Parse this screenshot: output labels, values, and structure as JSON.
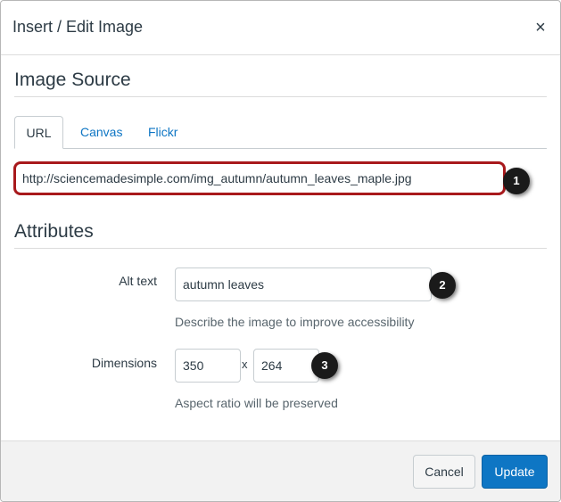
{
  "dialog": {
    "title": "Insert / Edit Image",
    "close_glyph": "×"
  },
  "image_source": {
    "heading": "Image Source",
    "tabs": [
      {
        "label": "URL",
        "active": true
      },
      {
        "label": "Canvas",
        "active": false
      },
      {
        "label": "Flickr",
        "active": false
      }
    ],
    "url_value": "http://sciencemadesimple.com/img_autumn/autumn_leaves_maple.jpg"
  },
  "attributes": {
    "heading": "Attributes",
    "alt_text": {
      "label": "Alt text",
      "value": "autumn leaves",
      "hint": "Describe the image to improve accessibility"
    },
    "dimensions": {
      "label": "Dimensions",
      "width": "350",
      "separator": "x",
      "height": "264",
      "hint": "Aspect ratio will be preserved"
    }
  },
  "callouts": [
    "1",
    "2",
    "3"
  ],
  "footer": {
    "cancel_label": "Cancel",
    "update_label": "Update"
  },
  "colors": {
    "accent": "#0e76c4",
    "highlight_border": "#a8191c",
    "callout_bg": "#1a1a1a"
  }
}
